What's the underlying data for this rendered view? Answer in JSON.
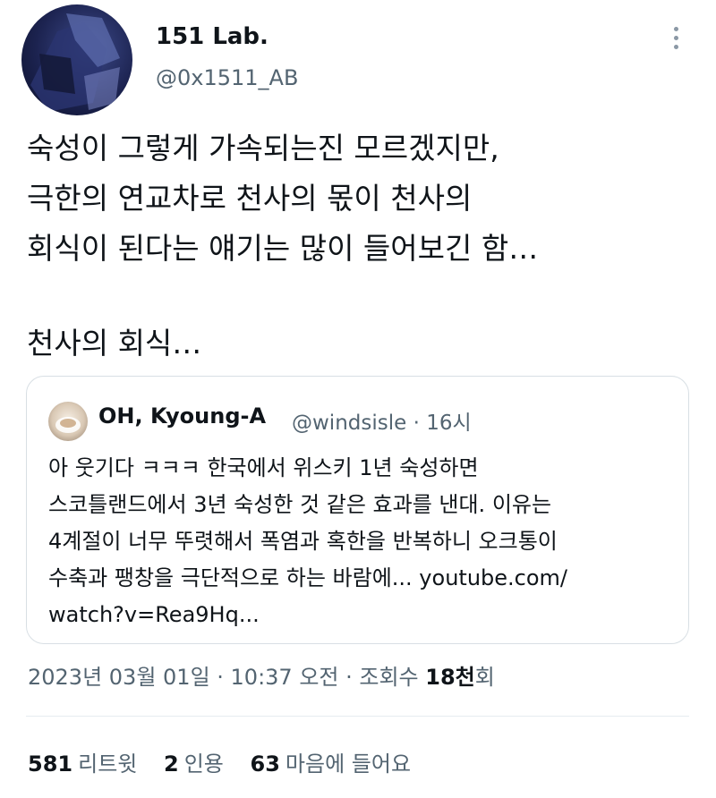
{
  "author": {
    "display_name": "151 Lab.",
    "handle": "@0x1511_AB"
  },
  "more_icon": "more-vertical-icon",
  "tweet": {
    "lines": [
      "숙성이 그렇게 가속되는진 모르겠지만,",
      "극한의 연교차로 천사의 몫이 천사의",
      "회식이 된다는 얘기는 많이 들어보긴 함…"
    ],
    "line_after_gap": "천사의 회식…"
  },
  "quote": {
    "display_name": "OH, Kyoung-A",
    "meta": "@windsisle · 16시",
    "lines": [
      "아 웃기다 ㅋㅋㅋ 한국에서 위스키 1년 숙성하면",
      "스코틀랜드에서 3년 숙성한 것 같은 효과를 낸대. 이유는",
      "4계절이 너무 뚜렷해서 폭염과 혹한을 반복하니 오크통이",
      "수축과 팽창을 극단적으로 하는 바람에... youtube.com/",
      "watch?v=Rea9Hq..."
    ]
  },
  "timestamp": {
    "date_time": "2023년 03월 01일 · 10:37 오전 · 조회수 ",
    "views_number": "18천",
    "views_suffix": "회"
  },
  "stats": {
    "retweets_count": "581",
    "retweets_label": "리트윗",
    "quotes_count": "2",
    "quotes_label": "인용",
    "likes_count": "63",
    "likes_label": "마음에 들어요"
  },
  "colors": {
    "primary_text": "#0f1419",
    "secondary_text": "#536471",
    "border": "#d8dfe4"
  }
}
